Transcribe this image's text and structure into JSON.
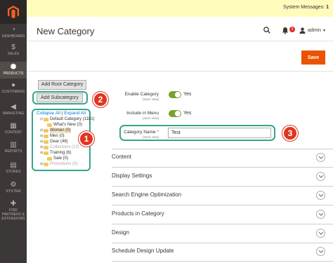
{
  "sidebar": {
    "items": [
      {
        "label": "DASHBOARD",
        "icon": "dashboard-icon"
      },
      {
        "label": "SALES",
        "icon": "dollar-icon"
      },
      {
        "label": "PRODUCTS",
        "icon": "box-icon"
      },
      {
        "label": "CUSTOMERS",
        "icon": "person-icon"
      },
      {
        "label": "MARKETING",
        "icon": "megaphone-icon"
      },
      {
        "label": "CONTENT",
        "icon": "content-icon"
      },
      {
        "label": "REPORTS",
        "icon": "bar-chart-icon"
      },
      {
        "label": "STORES",
        "icon": "store-icon"
      },
      {
        "label": "SYSTEM",
        "icon": "gear-icon"
      },
      {
        "label": "FIND PARTNERS & EXTENSIONS",
        "icon": "puzzle-icon"
      }
    ]
  },
  "system_messages": {
    "label": "System Messages:",
    "count": "1"
  },
  "header": {
    "title": "New Category",
    "notification_count": "6",
    "user": "admin"
  },
  "actions": {
    "save_label": "Save"
  },
  "tree_panel": {
    "add_root_label": "Add Root Category",
    "add_sub_label": "Add Subcategory",
    "collapse_all": "Collapse All",
    "separator": "|",
    "expand_all": "Expand All",
    "nodes": [
      {
        "label": "Default Category (1181)",
        "state": "normal"
      },
      {
        "label": "What's New (0)",
        "state": "normal"
      },
      {
        "label": "Women (0)",
        "state": "selected"
      },
      {
        "label": "Men (0)",
        "state": "normal"
      },
      {
        "label": "Gear (46)",
        "state": "normal"
      },
      {
        "label": "Collections (13)",
        "state": "dim"
      },
      {
        "label": "Training (6)",
        "state": "normal"
      },
      {
        "label": "Sale (0)",
        "state": "normal"
      },
      {
        "label": "Promotions (0)",
        "state": "dim"
      }
    ]
  },
  "callouts": {
    "one": "1",
    "two": "2",
    "three": "3"
  },
  "form": {
    "enable": {
      "label": "Enable Category",
      "scope": "[store view]",
      "value": "Yes"
    },
    "menu": {
      "label": "Include in Menu",
      "scope": "[store view]",
      "value": "Yes"
    },
    "name": {
      "label": "Category Name",
      "required": "*",
      "scope": "[store view]",
      "value": "Test"
    }
  },
  "sections": [
    {
      "title": "Content"
    },
    {
      "title": "Display Settings"
    },
    {
      "title": "Search Engine Optimization"
    },
    {
      "title": "Products in Category"
    },
    {
      "title": "Design"
    },
    {
      "title": "Schedule Design Update"
    }
  ],
  "colors": {
    "accent": "#eb5202",
    "highlight": "#37a48a",
    "callout": "#e03520",
    "toggle_on": "#79a22e"
  }
}
